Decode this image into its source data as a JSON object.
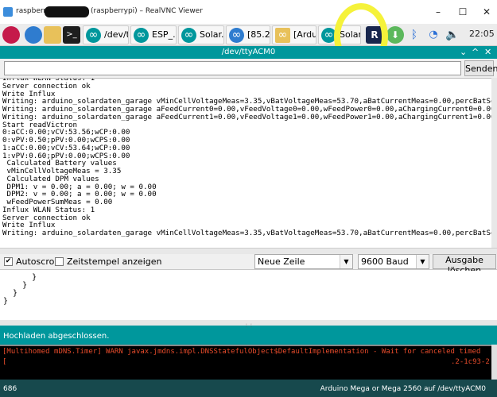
{
  "vnc": {
    "title_host": "raspberryp",
    "title_rest": "(raspberrypi) – RealVNC Viewer",
    "minimize": "–",
    "maximize": "☐",
    "close": "✕"
  },
  "taskbar": {
    "tasks": [
      {
        "label": "/dev/t..."
      },
      {
        "label": "ESP_..."
      },
      {
        "label": "Solar..."
      },
      {
        "label": "[85.21..."
      },
      {
        "label": "[Ardui..."
      },
      {
        "label": "Solar..."
      }
    ],
    "clock": "22:05"
  },
  "monitor": {
    "title": "/dev/ttyACM0",
    "collapse": "⌄",
    "maximize": "^",
    "close": "✕",
    "send_label": "Senden",
    "input_value": "",
    "output_lines": [
      "Influx WLAN Status: 1",
      "Server connection ok",
      "Write Influx",
      "Writing: arduino_solardaten_garage vMinCellVoltageMeas=3.35,vBatVoltageMeas=53.70,aBatCurrentMeas=0.00,percBatSo",
      "Writing: arduino_solardaten_garage aFeedCurrent0=0.00,vFeedVoltage0=0.00,wFeedPower0=0.00,aChargingCurrent0=0.00",
      "Writing: arduino_solardaten_garage aFeedCurrent1=0.00,vFeedVoltage1=0.00,wFeedPower1=0.00,aChargingCurrent1=0.00",
      "Start readVictron",
      "0:aCC:0.00;vCV:53.56;wCP:0.00",
      "0:vPV:0.50;pPV:0.00;wCPS:0.00",
      "1:aCC:0.00;vCV:53.64;wCP:0.00",
      "1:vPV:0.60;pPV:0.00;wCPS:0.00",
      " Calculated Battery values",
      " vMinCellVoltageMeas = 3.35",
      " Calculated DPM values",
      " DPM1: v = 0.00; a = 0.00; w = 0.00",
      " DPM2: v = 0.00; a = 0.00; w = 0.00",
      " wFeedPowerSumMeas = 0.00",
      "Influx WLAN Status: 1",
      "Server connection ok",
      "Write Influx",
      "Writing: arduino_solardaten_garage vMinCellVoltageMeas=3.35,vBatVoltageMeas=53.70,aBatCurrentMeas=0.00,percBatSo"
    ],
    "autoscroll_label": "Autoscroll",
    "autoscroll_checked": "✔",
    "timestamp_label": "Zeitstempel anzeigen",
    "line_ending": "Neue Zeile",
    "baud": "9600 Baud",
    "clear_label": "Ausgabe löschen",
    "dropdown_arrow": "▼"
  },
  "editor": {
    "lines": [
      "      }",
      "    }",
      "  }",
      "}"
    ]
  },
  "status": {
    "message": "Hochladen abgeschlossen.",
    "grip": "⋮⋮"
  },
  "console": {
    "line1": "[Multihomed mDNS.Timer] WARN javax.jmdns.impl.DNSStatefulObject$DefaultImplementation - Wait for canceled timed",
    "line2": "[",
    "line2_tail": ".2-1c93-2"
  },
  "footer": {
    "line": "686",
    "board": "Arduino Mega or Mega 2560 auf /dev/ttyACM0"
  },
  "colors": {
    "arduino_teal": "#00979c",
    "footer_dark": "#17494d",
    "highlight_yellow": "#f5f23a",
    "console_red": "#e64b2b"
  }
}
